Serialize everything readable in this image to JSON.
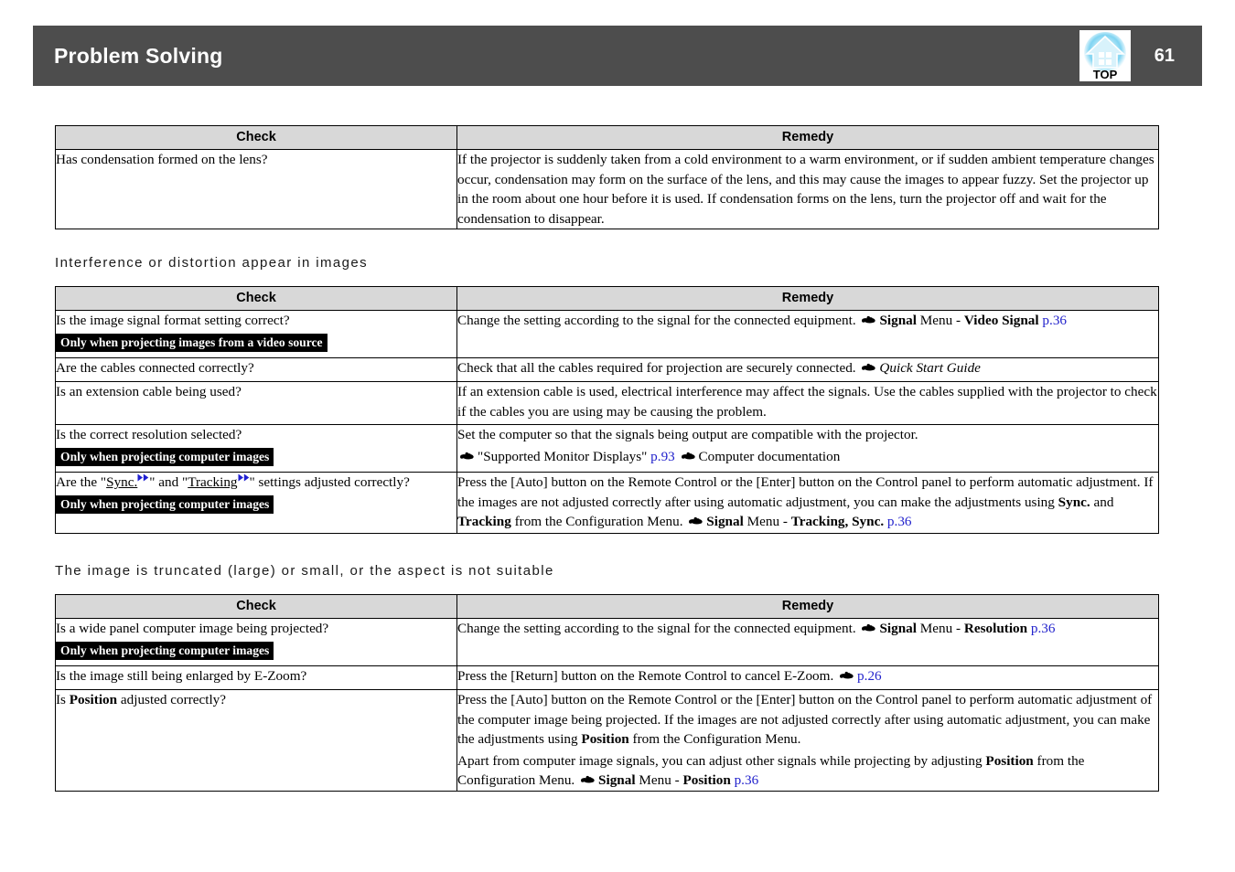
{
  "header": {
    "title": "Problem Solving",
    "page_number": "61",
    "top_logo_label": "TOP",
    "bar_color": "#4d4d4d"
  },
  "link_color": "#2222cc",
  "table_header_bg": "#d8d8d8",
  "columns": {
    "check": "Check",
    "remedy": "Remedy"
  },
  "sections": [
    {
      "heading": null,
      "rows": [
        {
          "check": "Has condensation formed on the lens?",
          "badge": null,
          "remedy": "If the projector is suddenly taken from a cold environment to a warm environment, or if sudden ambient temperature changes occur, condensation may form on the surface of the lens, and this may cause the images to appear fuzzy. Set the projector up in the room about one hour before it is used. If condensation forms on the lens, turn the projector off and wait for the condensation to disappear."
        }
      ]
    },
    {
      "heading": "Interference  or  distortion  appear  in  images",
      "rows": [
        {
          "check": "Is the image signal format setting correct?",
          "badge": "Only when projecting images from a video source",
          "remedy_parts": [
            {
              "t": "Change the setting according to the signal for the connected equipment. "
            },
            {
              "icon": "pointing-hand-icon"
            },
            {
              "t": "Signal",
              "style": "bold"
            },
            {
              "t": " Menu - "
            },
            {
              "t": "Video Signal",
              "style": "bold"
            },
            {
              "t": " "
            },
            {
              "t": "p.36",
              "style": "link"
            }
          ]
        },
        {
          "check": "Are the cables connected correctly?",
          "badge": null,
          "remedy_parts": [
            {
              "t": "Check that all the cables required for projection are securely connected. "
            },
            {
              "icon": "pointing-hand-icon"
            },
            {
              "t": "Quick Start Guide",
              "style": "italic"
            }
          ]
        },
        {
          "check": "Is an extension cable being used?",
          "badge": null,
          "remedy_parts": [
            {
              "t": "If an extension cable is used, electrical interference may affect the signals. Use the cables supplied with the projector to check if the cables you are using may be causing the problem."
            }
          ]
        },
        {
          "check": "Is the correct resolution selected?",
          "badge": "Only when projecting computer images",
          "remedy_lines": [
            [
              {
                "t": "Set the computer so that the signals being output are compatible with the projector."
              }
            ],
            [
              {
                "icon": "pointing-hand-icon"
              },
              {
                "t": "\"Supported Monitor Displays\" "
              },
              {
                "t": "p.93",
                "style": "link"
              },
              {
                "t": " "
              },
              {
                "icon": "pointing-hand-icon"
              },
              {
                "t": "Computer documentation"
              }
            ]
          ]
        },
        {
          "check_parts": [
            {
              "t": "Are the \""
            },
            {
              "t": "Sync.",
              "style": "underline"
            },
            {
              "marker": "blue-double-triangle-icon"
            },
            {
              "t": "\" and \""
            },
            {
              "t": "Tracking",
              "style": "underline"
            },
            {
              "marker": "blue-double-triangle-icon"
            },
            {
              "t": "\" settings adjusted correctly?"
            }
          ],
          "badge": "Only when projecting computer images",
          "remedy_parts": [
            {
              "t": "Press the [Auto] button on the Remote Control or the [Enter] button on the Control panel to perform automatic adjustment. If the images are not adjusted correctly after using automatic adjustment, you can make the adjustments using "
            },
            {
              "t": "Sync.",
              "style": "bold"
            },
            {
              "t": " and "
            },
            {
              "t": "Tracking",
              "style": "bold"
            },
            {
              "t": " from the Configuration Menu. "
            },
            {
              "icon": "pointing-hand-icon"
            },
            {
              "t": "Signal",
              "style": "bold"
            },
            {
              "t": " Menu - "
            },
            {
              "t": "Tracking, Sync.",
              "style": "bold"
            },
            {
              "t": " "
            },
            {
              "t": "p.36",
              "style": "link"
            }
          ]
        }
      ]
    },
    {
      "heading": "The  image  is  truncated  (large)  or  small,  or  the  aspect  is  not  suitable",
      "rows": [
        {
          "check": "Is a wide panel computer image being projected?",
          "badge": "Only when projecting computer images",
          "remedy_parts": [
            {
              "t": "Change the setting according to the signal for the connected equipment. "
            },
            {
              "icon": "pointing-hand-icon"
            },
            {
              "t": "Signal",
              "style": "bold"
            },
            {
              "t": " Menu - "
            },
            {
              "t": "Resolution",
              "style": "bold"
            },
            {
              "t": " "
            },
            {
              "t": "p.36",
              "style": "link"
            }
          ]
        },
        {
          "check": "Is the image still being enlarged by E-Zoom?",
          "badge": null,
          "remedy_parts": [
            {
              "t": "Press the [Return] button on the Remote Control to cancel E-Zoom. "
            },
            {
              "icon": "pointing-hand-icon"
            },
            {
              "t": "p.26",
              "style": "link"
            }
          ]
        },
        {
          "check_parts": [
            {
              "t": "Is "
            },
            {
              "t": "Position",
              "style": "bold"
            },
            {
              "t": " adjusted correctly?"
            }
          ],
          "badge": null,
          "remedy_lines": [
            [
              {
                "t": "Press the [Auto] button on the Remote Control or the [Enter] button on the Control panel to perform automatic adjustment of the computer image being projected. If the images are not adjusted correctly after using automatic adjustment, you can make the adjustments using "
              },
              {
                "t": "Position",
                "style": "bold"
              },
              {
                "t": " from the Configuration Menu."
              }
            ],
            [
              {
                "t": "Apart from computer image signals, you can adjust other signals while projecting by adjusting "
              },
              {
                "t": "Position",
                "style": "bold"
              },
              {
                "t": " from the Configuration Menu. "
              },
              {
                "icon": "pointing-hand-icon"
              },
              {
                "t": "Signal",
                "style": "bold"
              },
              {
                "t": " Menu - "
              },
              {
                "t": "Position",
                "style": "bold"
              },
              {
                "t": " "
              },
              {
                "t": "p.36",
                "style": "link"
              }
            ]
          ]
        }
      ]
    }
  ]
}
